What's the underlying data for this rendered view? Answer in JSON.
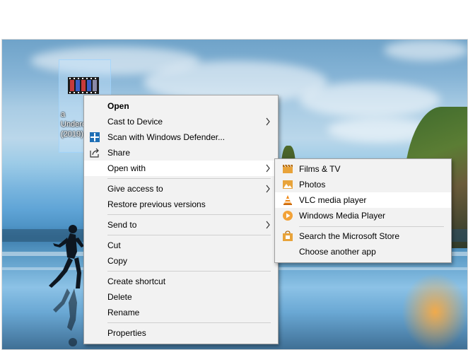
{
  "desktop": {
    "file": {
      "caption_lines": "a\nUnderc\n(2019)"
    }
  },
  "context_menu": {
    "items": [
      {
        "label": "Open",
        "bold": true
      },
      {
        "label": "Cast to Device",
        "submenu": true
      },
      {
        "label": "Scan with Windows Defender...",
        "icon": "defender-shield-icon"
      },
      {
        "label": "Share",
        "icon": "share-icon"
      },
      {
        "label": "Open with",
        "submenu": true,
        "highlighted": true
      },
      {
        "label": "Give access to",
        "submenu": true
      },
      {
        "label": "Restore previous versions"
      },
      {
        "label": "Send to",
        "submenu": true
      },
      {
        "label": "Cut"
      },
      {
        "label": "Copy"
      },
      {
        "label": "Create shortcut"
      },
      {
        "label": "Delete"
      },
      {
        "label": "Rename"
      },
      {
        "label": "Properties"
      }
    ]
  },
  "open_with_menu": {
    "items": [
      {
        "label": "Films & TV",
        "icon": "films-tv-icon"
      },
      {
        "label": "Photos",
        "icon": "photos-icon"
      },
      {
        "label": "VLC media player",
        "icon": "vlc-cone-icon",
        "highlighted": true
      },
      {
        "label": "Windows Media Player",
        "icon": "windows-media-player-icon"
      },
      {
        "label": "Search the Microsoft Store",
        "icon": "microsoft-store-icon"
      },
      {
        "label": "Choose another app"
      }
    ]
  },
  "colors": {
    "menu_bg": "#f2f2f2",
    "highlight": "#ffffff",
    "separator": "#cfcfcf"
  }
}
